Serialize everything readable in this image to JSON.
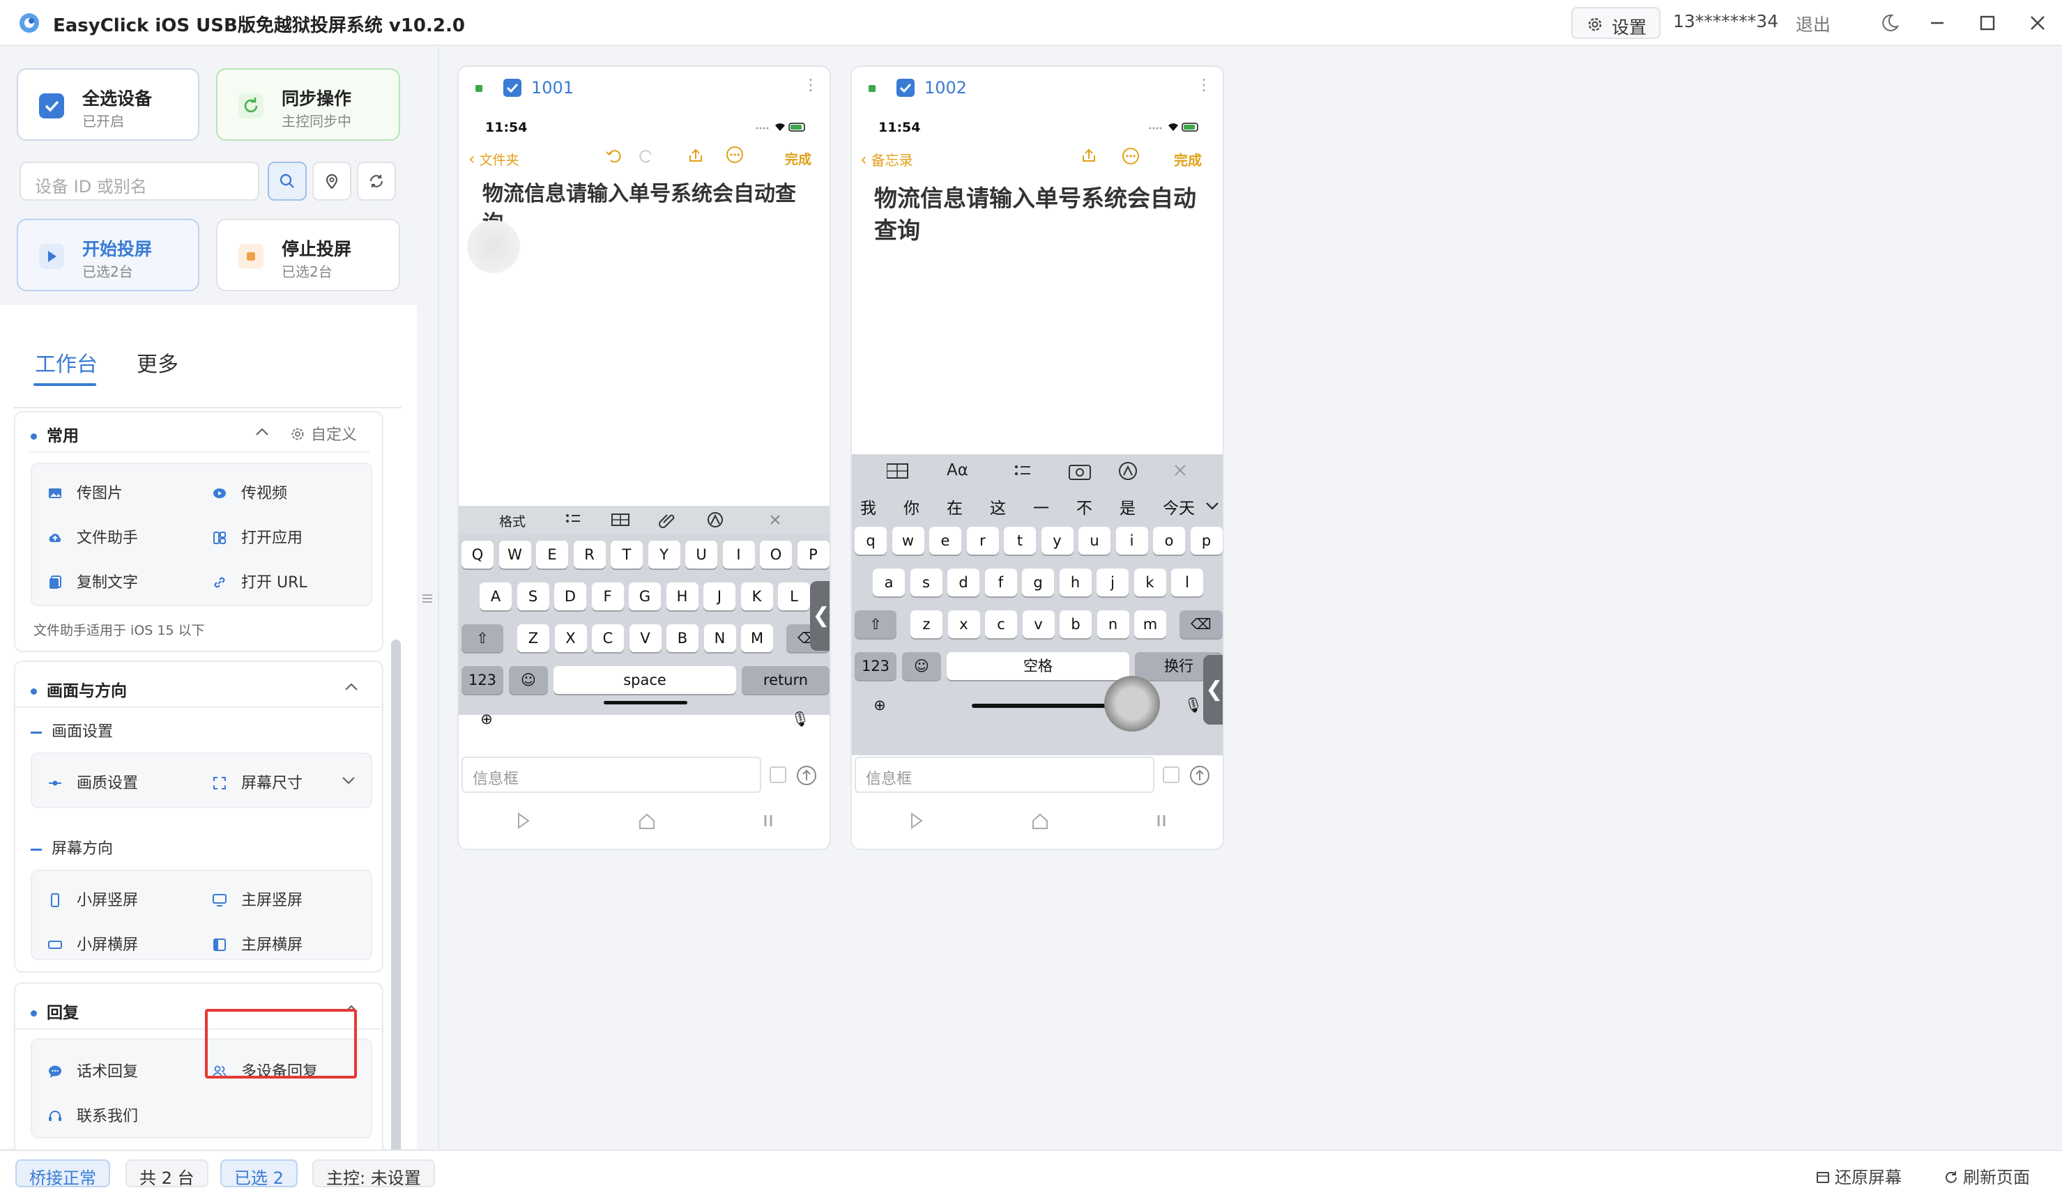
{
  "titlebar": {
    "app_title": "EasyClick iOS USB版免越狱投屏系统 v10.2.0",
    "settings_label": "设置",
    "account": "13*******34",
    "logout_label": "退出"
  },
  "sidebar": {
    "select_all": {
      "title": "全选设备",
      "subtitle": "已开启"
    },
    "sync": {
      "title": "同步操作",
      "subtitle": "主控同步中"
    },
    "search_placeholder": "设备 ID 或别名",
    "start": {
      "title": "开始投屏",
      "subtitle": "已选2台"
    },
    "stop": {
      "title": "停止投屏",
      "subtitle": "已选2台"
    },
    "tabs": [
      "工作台",
      "更多"
    ],
    "common": {
      "title": "常用",
      "customize": "自定义",
      "items": [
        "传图片",
        "传视频",
        "文件助手",
        "打开应用",
        "复制文字",
        "打开 URL"
      ],
      "note": "文件助手适用于 iOS 15 以下"
    },
    "display": {
      "title": "画面与方向",
      "screen_settings": "画面设置",
      "quality": "画质设置",
      "screen_size": "屏幕尺寸",
      "orientation": "屏幕方向",
      "orient_items": [
        "小屏竖屏",
        "主屏竖屏",
        "小屏横屏",
        "主屏横屏"
      ]
    },
    "reply": {
      "title": "回复",
      "items": [
        "话术回复",
        "多设备回复",
        "联系我们"
      ]
    }
  },
  "devices": [
    {
      "id": "1001",
      "time": "11:54",
      "back": "文件夹",
      "done": "完成",
      "note": "物流信息请输入单号系统会自动查询",
      "toolbar": "格式",
      "rows": [
        [
          "Q",
          "W",
          "E",
          "R",
          "T",
          "Y",
          "U",
          "I",
          "O",
          "P"
        ],
        [
          "A",
          "S",
          "D",
          "F",
          "G",
          "H",
          "J",
          "K",
          "L"
        ],
        [
          "Z",
          "X",
          "C",
          "V",
          "B",
          "N",
          "M"
        ]
      ],
      "num": "123",
      "space": "space",
      "ret": "return",
      "msg_placeholder": "信息框"
    },
    {
      "id": "1002",
      "time": "11:54",
      "back": "备忘录",
      "done": "完成",
      "note": "物流信息请输入单号系统会自动查询",
      "toolbar": "Aα",
      "candidates": [
        "我",
        "你",
        "在",
        "这",
        "一",
        "不",
        "是",
        "今天"
      ],
      "rows": [
        [
          "q",
          "w",
          "e",
          "r",
          "t",
          "y",
          "u",
          "i",
          "o",
          "p"
        ],
        [
          "a",
          "s",
          "d",
          "f",
          "g",
          "h",
          "j",
          "k",
          "l"
        ],
        [
          "z",
          "x",
          "c",
          "v",
          "b",
          "n",
          "m"
        ]
      ],
      "num": "123",
      "space": "空格",
      "ret": "换行",
      "msg_placeholder": "信息框"
    }
  ],
  "statusbar": {
    "bridge": "桥接正常",
    "total": "共 2 台",
    "selected": "已选 2",
    "master": "主控: 未设置",
    "restore": "还原屏幕",
    "refresh": "刷新页面"
  },
  "colors": {
    "accent": "#3a7bd5",
    "status_green": "#3ca84b",
    "highlight": "#e53935",
    "ios_yellow": "#e0a11a"
  }
}
